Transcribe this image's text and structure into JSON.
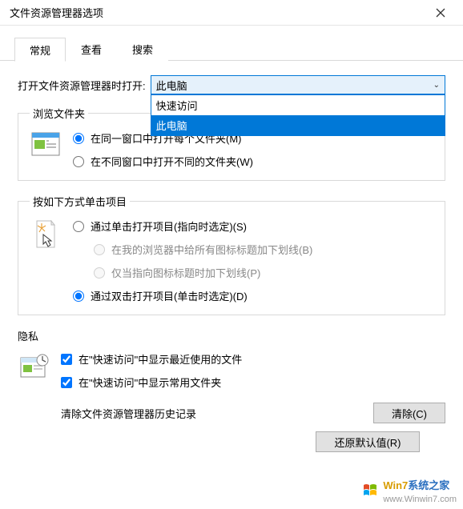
{
  "window": {
    "title": "文件资源管理器选项"
  },
  "tabs": {
    "general": "常规",
    "view": "查看",
    "search": "搜索"
  },
  "open_with": {
    "label": "打开文件资源管理器时打开:",
    "selected": "此电脑",
    "options": {
      "quick": "快速访问",
      "thispc": "此电脑"
    }
  },
  "browse": {
    "legend": "浏览文件夹",
    "same_window": "在同一窗口中打开每个文件夹(M)",
    "new_window": "在不同窗口中打开不同的文件夹(W)"
  },
  "click": {
    "legend": "按如下方式单击项目",
    "single": "通过单击打开项目(指向时选定)(S)",
    "underline_browser": "在我的浏览器中给所有图标标题加下划线(B)",
    "underline_point": "仅当指向图标标题时加下划线(P)",
    "double": "通过双击打开项目(单击时选定)(D)"
  },
  "privacy": {
    "legend": "隐私",
    "recent_files": "在\"快速访问\"中显示最近使用的文件",
    "frequent_folders": "在\"快速访问\"中显示常用文件夹",
    "clear_label": "清除文件资源管理器历史记录",
    "clear_button": "清除(C)"
  },
  "footer": {
    "restore": "还原默认值(R)"
  },
  "watermark": {
    "brand1": "Win7",
    "brand2": "系统之家",
    "domain": "www.Winwin7.com"
  }
}
